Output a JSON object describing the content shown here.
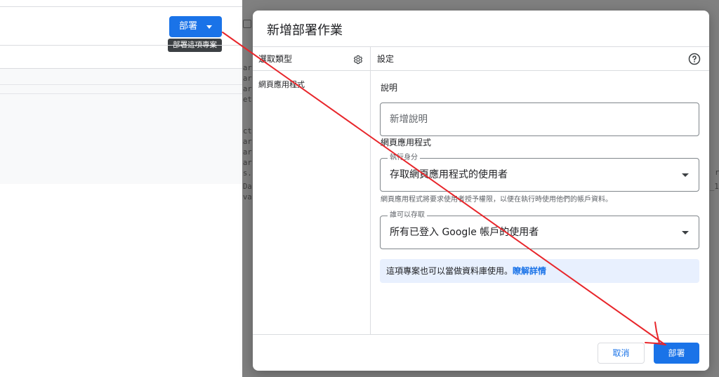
{
  "editor": {
    "deploy_button": {
      "label": "部署",
      "icon": "caret-down-icon"
    },
    "deploy_tooltip": "部署這項專案",
    "code_fragments_left": [
      "ar",
      "ar",
      "ar",
      "et",
      "ct",
      "ar",
      "ar",
      "ar",
      "s.",
      "Da",
      "va"
    ],
    "code_fragments_right": [
      "r",
      "_1"
    ]
  },
  "dialog": {
    "title": "新增部署作業",
    "type_panel": {
      "header": "選取類型",
      "header_icon": "gear-icon",
      "items": [
        {
          "label": "網頁應用程式"
        }
      ]
    },
    "settings_panel": {
      "header": "設定",
      "header_icon": "help-circle-icon",
      "description": {
        "label": "說明",
        "placeholder": "新增說明"
      },
      "section_title": "網頁應用程式",
      "execute_as": {
        "label": "執行身分",
        "value": "存取網頁應用程式的使用者",
        "helper": "網頁應用程式將要求使用者授予權限，以便在執行時使用他們的帳戶資料。"
      },
      "who_has_access": {
        "label": "誰可以存取",
        "value": "所有已登入 Google 帳戶的使用者"
      },
      "info_banner": {
        "text": "這項專案也可以當做資料庫使用。",
        "link": "瞭解詳情"
      }
    },
    "footer": {
      "cancel_label": "取消",
      "deploy_label": "部署"
    }
  },
  "colors": {
    "accent": "#1a73e8",
    "annotation": "#e8262b",
    "scrim": "#808080",
    "info_background": "#e8f0fe",
    "tooltip": "#3c4043"
  }
}
